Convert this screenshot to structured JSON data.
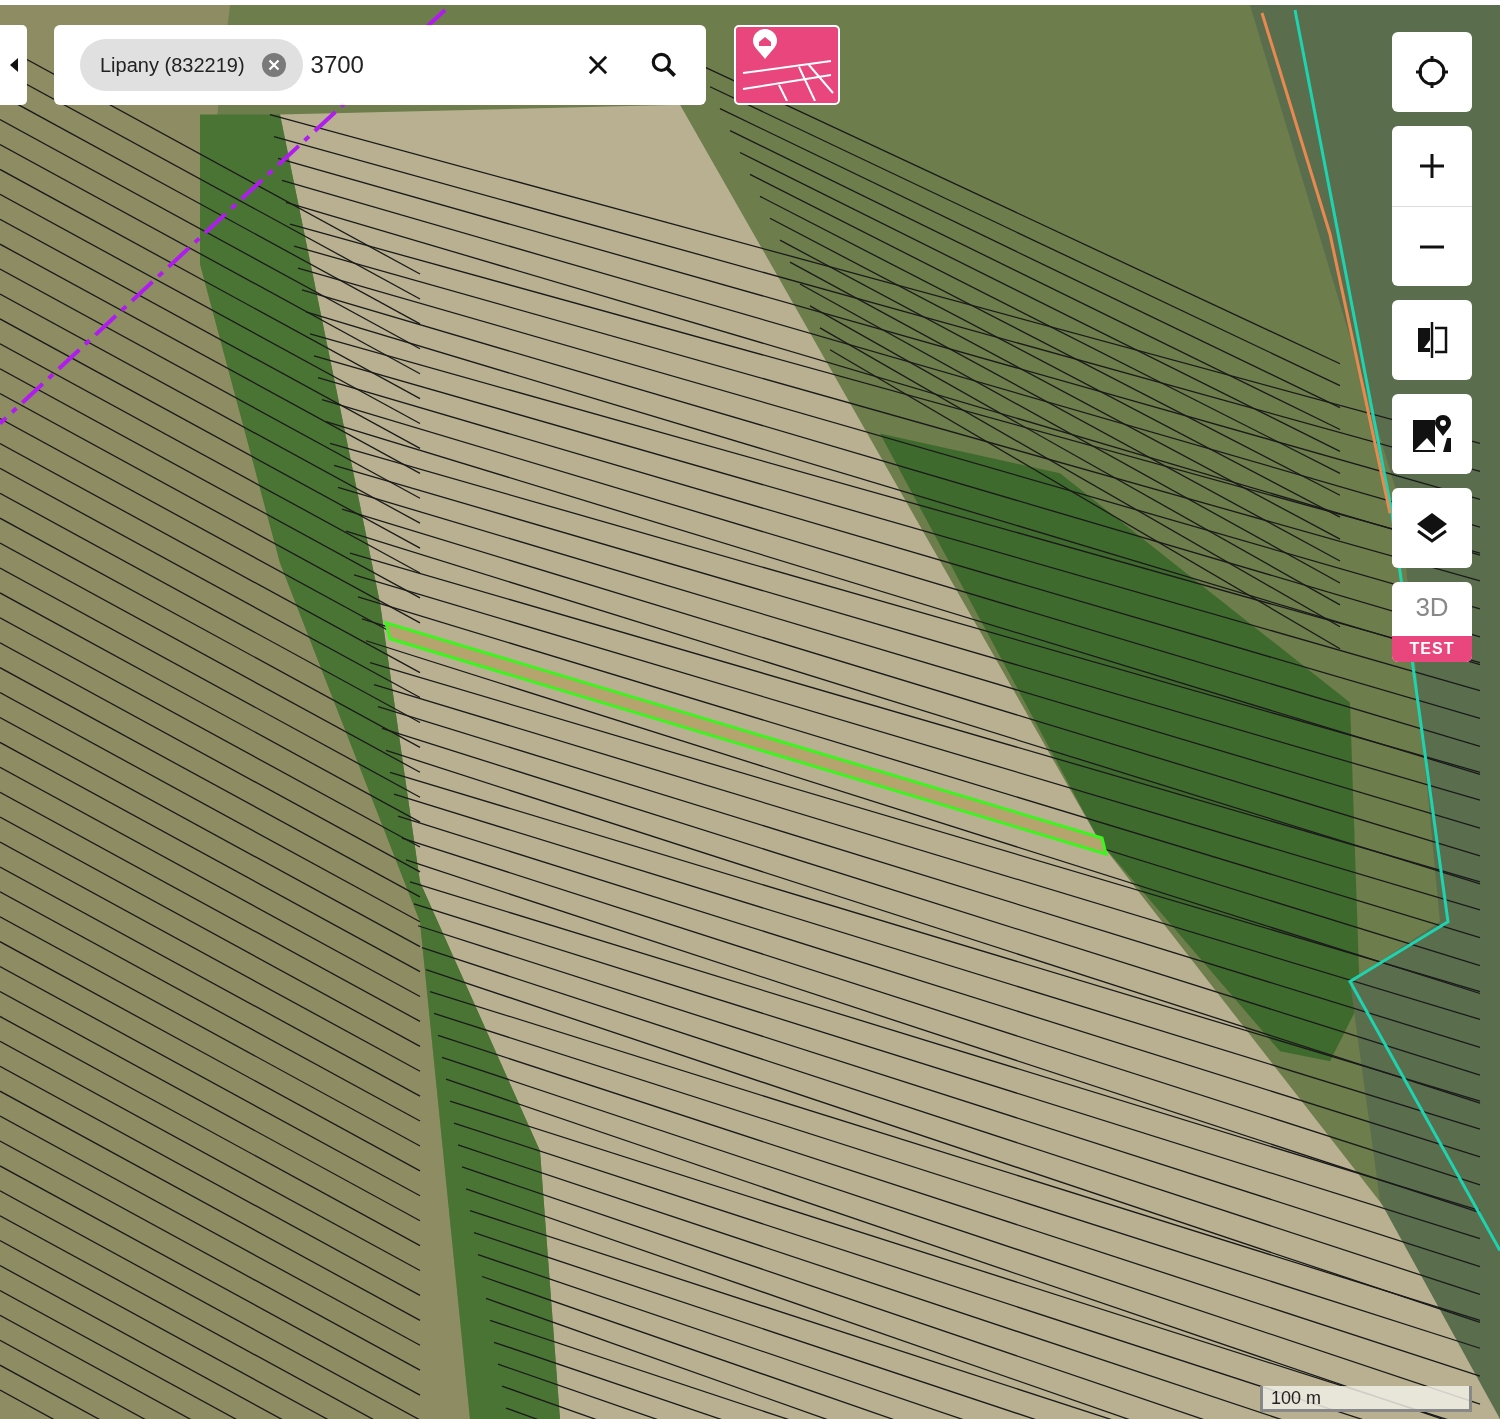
{
  "search": {
    "chip": {
      "label": "Lipany (832219)"
    },
    "value": "3700"
  },
  "view_3d": {
    "label": "3D",
    "badge": "TEST"
  },
  "scale_bar": {
    "label": "100 m"
  }
}
